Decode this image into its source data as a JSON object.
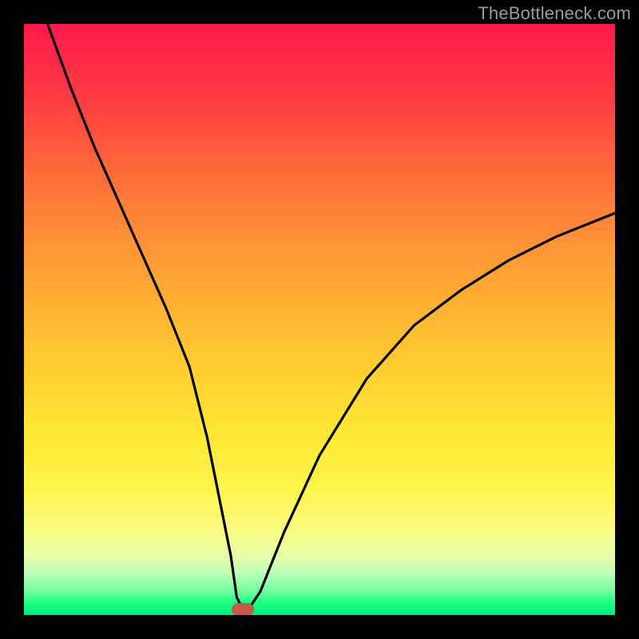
{
  "watermark": "TheBottleneck.com",
  "colors": {
    "frame": "#000000",
    "marker": "#c85a4a",
    "curve": "#000000"
  },
  "chart_data": {
    "type": "line",
    "title": "",
    "xlabel": "",
    "ylabel": "",
    "xlim": [
      0,
      100
    ],
    "ylim": [
      0,
      100
    ],
    "grid": false,
    "marker": {
      "x": 37,
      "y": 1
    },
    "series": [
      {
        "name": "bottleneck-curve",
        "x": [
          4,
          8,
          12,
          16,
          20,
          24,
          28,
          31,
          33,
          35,
          36,
          37,
          38,
          40,
          44,
          50,
          58,
          66,
          74,
          82,
          90,
          100
        ],
        "values": [
          100,
          89,
          79,
          70,
          61,
          52,
          42,
          30,
          20,
          10,
          3,
          1,
          1,
          4,
          14,
          27,
          40,
          49,
          55,
          60,
          64,
          68
        ]
      }
    ]
  }
}
